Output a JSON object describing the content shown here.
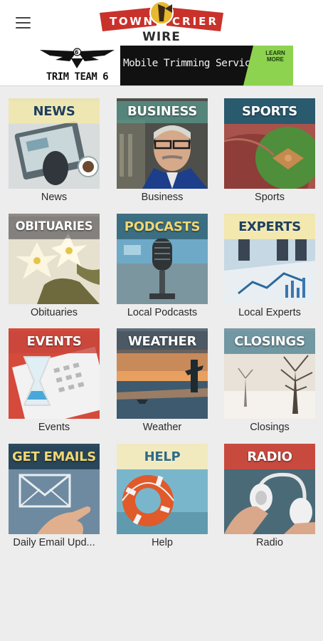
{
  "header": {
    "menu_icon": "hamburger-menu-icon",
    "logo": {
      "word1": "TOWN",
      "word2": "CRIER",
      "word3": "WIRE"
    }
  },
  "ad": {
    "brand": "TRIM TEAM 6",
    "headline": "Mobile Trimming Services",
    "cta": "LEARN MORE"
  },
  "tiles": [
    {
      "key": "news",
      "title": "NEWS",
      "label": "News"
    },
    {
      "key": "business",
      "title": "BUSINESS",
      "label": "Business"
    },
    {
      "key": "sports",
      "title": "SPORTS",
      "label": "Sports"
    },
    {
      "key": "obituaries",
      "title": "OBITUARIES",
      "label": "Obituaries"
    },
    {
      "key": "podcasts",
      "title": "PODCASTS",
      "label": "Local Podcasts"
    },
    {
      "key": "experts",
      "title": "EXPERTS",
      "label": "Local Experts"
    },
    {
      "key": "events",
      "title": "EVENTS",
      "label": "Events"
    },
    {
      "key": "weather",
      "title": "WEATHER",
      "label": "Weather"
    },
    {
      "key": "closings",
      "title": "CLOSINGS",
      "label": "Closings"
    },
    {
      "key": "emails",
      "title": "GET EMAILS",
      "label": "Daily Email Upd..."
    },
    {
      "key": "help",
      "title": "HELP",
      "label": "Help"
    },
    {
      "key": "radio",
      "title": "RADIO",
      "label": "Radio"
    }
  ],
  "colors": {
    "logo_red": "#c8322b",
    "logo_gold": "#e8b92f",
    "ad_green": "#8ed34f",
    "background": "#ededed"
  }
}
